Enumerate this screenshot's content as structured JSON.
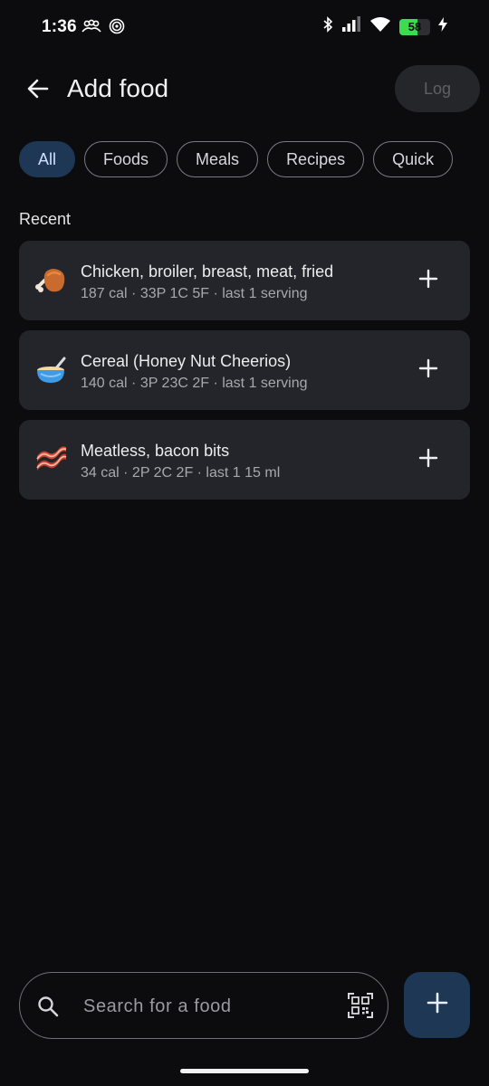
{
  "status_bar": {
    "time": "1:36",
    "battery_level": "58",
    "battery_fraction": 0.58,
    "battery_color": "#3ddc4f",
    "icons": [
      "people-icon",
      "target-icon",
      "bluetooth-icon",
      "signal-icon",
      "wifi-icon",
      "battery-icon",
      "charging-icon"
    ]
  },
  "header": {
    "title": "Add food",
    "log_label": "Log"
  },
  "filters": {
    "tabs": [
      "All",
      "Foods",
      "Meals",
      "Recipes",
      "Quick"
    ],
    "active": "All"
  },
  "recent": {
    "label": "Recent",
    "items": [
      {
        "icon": "poultry-leg-icon",
        "name": "Chicken, broiler, breast, meat, fried",
        "meta": "187 cal · 33P 1C 5F · last 1 serving"
      },
      {
        "icon": "bowl-with-spoon-icon",
        "name": "Cereal (Honey Nut Cheerios)",
        "meta": "140 cal · 3P 23C 2F · last 1 serving"
      },
      {
        "icon": "bacon-icon",
        "name": "Meatless, bacon bits",
        "meta": "34 cal · 2P 2C 2F · last 1 15 ml"
      }
    ]
  },
  "search": {
    "placeholder": "Search for a food",
    "value": ""
  },
  "colors": {
    "background": "#0c0c0e",
    "card": "#24252a",
    "accent": "#1d3755"
  }
}
